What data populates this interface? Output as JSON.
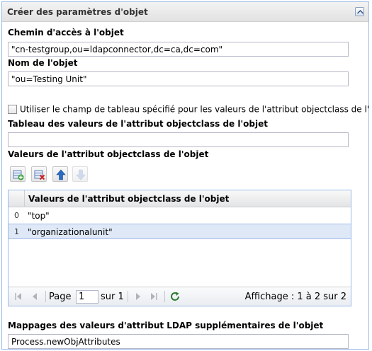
{
  "panel": {
    "title": "Créer des paramètres d'objet"
  },
  "fields": {
    "path_label": "Chemin d'accès à l'objet",
    "path_value": "\"cn-testgroup,ou=ldapconnector,dc=ca,dc=com\"",
    "name_label": "Nom de l'objet",
    "name_value": "\"ou=Testing Unit\"",
    "checkbox_label": "Utiliser le champ de tableau spécifié pour les valeurs de l'attribut objectclass de l'obje",
    "table_field_label": "Tableau des valeurs de l'attribut objectclass de l'objet",
    "table_field_value": "",
    "values_label": "Valeurs de l'attribut objectclass de l'objet",
    "mappings_label": "Mappages des valeurs d'attribut LDAP supplémentaires de l'objet",
    "mappings_value": "Process.newObjAttributes"
  },
  "grid": {
    "column_header": "Valeurs de l'attribut objectclass de l'objet",
    "rows": [
      {
        "num": "0",
        "value": "\"top\""
      },
      {
        "num": "1",
        "value": "\"organizationalunit\""
      }
    ],
    "selected_row": 1
  },
  "pager": {
    "page_label": "Page",
    "page_value": "1",
    "of_label": "sur 1",
    "display_info": "Affichage : 1 à 2 sur 2"
  },
  "icons": {
    "add": "add-row-icon",
    "delete": "delete-row-icon",
    "up": "move-up-icon",
    "down": "move-down-icon",
    "refresh": "refresh-icon"
  },
  "colors": {
    "panel_border": "#99bbe8",
    "selected_row": "#dfe8f6",
    "arrow_blue": "#2a6cc4"
  }
}
